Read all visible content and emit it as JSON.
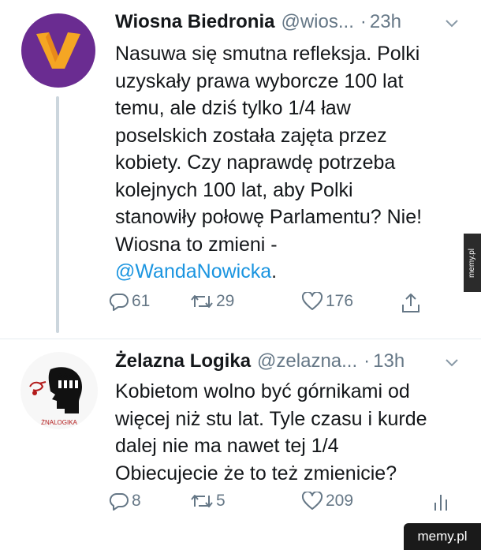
{
  "tweets": [
    {
      "author": {
        "name": "Wiosna Biedronia",
        "handle": "@wios...",
        "time": "23h"
      },
      "text_lines": [
        "Nasuwa się smutna refleksja. Polki",
        "uzyskały prawa wyborcze 100 lat",
        "temu, ale dziś tylko 1/4 ław",
        "poselskich została zajęta przez",
        "kobiety. Czy naprawdę potrzeba",
        "kolejnych 100 lat, aby Polki",
        "stanowiły połowę Parlamentu? Nie!",
        "Wiosna to zmieni -"
      ],
      "mention": "@WandaNowicka",
      "mention_suffix": ".",
      "actions": {
        "replies": "61",
        "retweets": "29",
        "likes": "176"
      }
    },
    {
      "author": {
        "name": "Żelazna Logika",
        "handle": "@zelazna...",
        "time": "13h"
      },
      "avatar_text": "ŻNALOGIKA",
      "text_lines": [
        "Kobietom wolno być górnikami od",
        "więcej niż stu lat. Tyle czasu i kurde",
        "dalej nie ma nawet tej 1/4",
        "Obiecujecie że to też zmienicie?"
      ],
      "actions": {
        "replies": "8",
        "retweets": "5",
        "likes": "209"
      }
    }
  ],
  "watermark": {
    "side": "memy.pl",
    "corner": "memy.pl"
  },
  "icons": [
    "reply-icon",
    "retweet-icon",
    "like-icon",
    "share-icon",
    "analytics-icon",
    "chevron-down-icon"
  ],
  "colors": {
    "avatar_bg": "#6a2c91",
    "avatar_logo": "#f5a623",
    "link": "#1b95e0",
    "muted": "#657786"
  }
}
